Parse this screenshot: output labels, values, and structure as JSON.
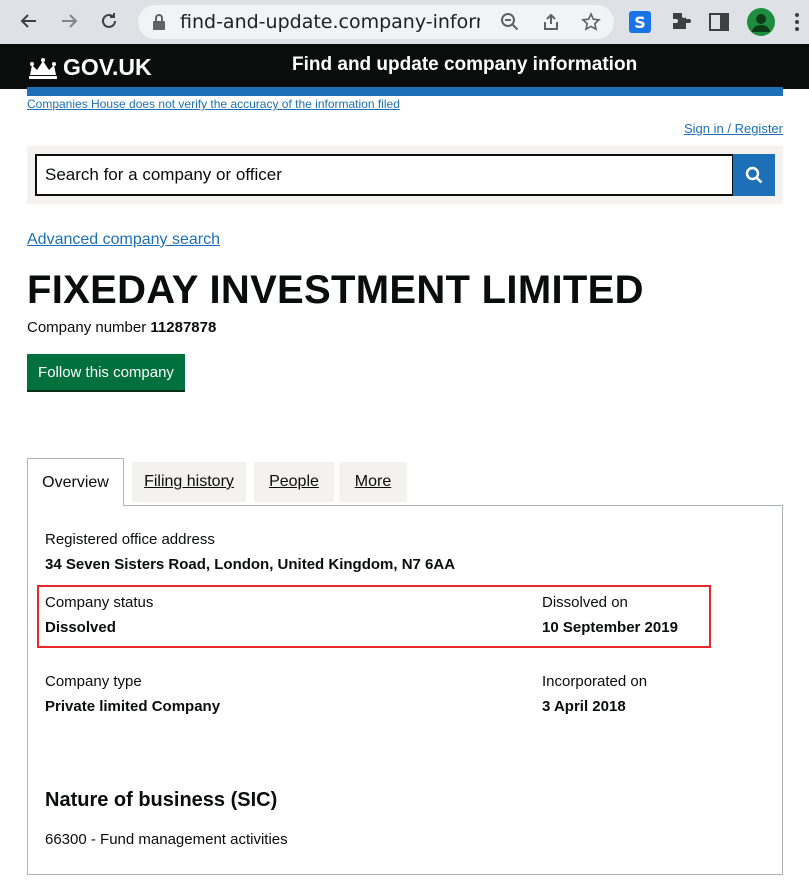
{
  "browser": {
    "url": "find-and-update.company-informa..."
  },
  "header": {
    "logo_text": "GOV.UK",
    "service_name": "Find and update company information"
  },
  "disclaimer": "Companies House does not verify the accuracy of the information filed",
  "signin": "Sign in / Register",
  "search": {
    "placeholder": "Search for a company or officer"
  },
  "advanced_search": "Advanced company search",
  "company": {
    "name": "FIXEDAY INVESTMENT LIMITED",
    "number_label": "Company number",
    "number": "11287878",
    "follow_label": "Follow this company"
  },
  "tabs": [
    {
      "label": "Overview",
      "active": true
    },
    {
      "label": "Filing history",
      "active": false
    },
    {
      "label": "People",
      "active": false
    },
    {
      "label": "More",
      "active": false
    }
  ],
  "overview": {
    "registered_office_label": "Registered office address",
    "registered_office_value": "34 Seven Sisters Road, London, United Kingdom, N7 6AA",
    "status_label": "Company status",
    "status_value": "Dissolved",
    "dissolved_label": "Dissolved on",
    "dissolved_value": "10 September 2019",
    "type_label": "Company type",
    "type_value": "Private limited Company",
    "incorporated_label": "Incorporated on",
    "incorporated_value": "3 April 2018"
  },
  "sic": {
    "heading": "Nature of business (SIC)",
    "item": "66300 - Fund management activities"
  },
  "colors": {
    "govuk_blue": "#1d70b8",
    "govuk_green": "#00703c",
    "highlight_red": "#e8282a"
  }
}
